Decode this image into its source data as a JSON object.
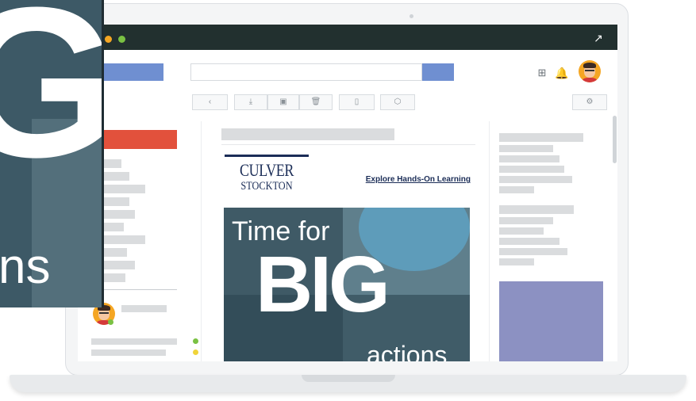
{
  "window": {
    "controls": [
      {
        "name": "close",
        "color": "#e2513c"
      },
      {
        "name": "minimize",
        "color": "#f5a623"
      },
      {
        "name": "maximize",
        "color": "#7ac143"
      }
    ],
    "expand_icon": "↗"
  },
  "topbar": {
    "grid_icon": "⊞",
    "bell_icon": "🔔",
    "compose_color": "#6f8fd1",
    "search_button_color": "#6f8fd1"
  },
  "toolbar": {
    "items": [
      {
        "name": "back",
        "icon": "‹"
      },
      {
        "name": "download",
        "icon": "⤓"
      },
      {
        "name": "archive",
        "icon": "▣"
      },
      {
        "name": "delete",
        "icon": "🗑"
      },
      {
        "name": "file",
        "icon": "▯"
      },
      {
        "name": "tag",
        "icon": "⬡"
      },
      {
        "name": "settings",
        "icon": "⚙"
      }
    ]
  },
  "sidebar": {
    "primary_button_color": "#e2513c",
    "presence_colors": [
      "#7ac143",
      "#f0d43a"
    ]
  },
  "email": {
    "logo_line1": "CULVER",
    "logo_line2": "STOCKTON",
    "link_text": "Explore Hands-On Learning",
    "hero_line1": "Time for",
    "hero_big": "BIG",
    "hero_line3": "actions"
  },
  "overlay": {
    "big_letter": "G",
    "partial_word": "ns"
  },
  "right_panel": {
    "ad_color": "#8c91c2"
  }
}
